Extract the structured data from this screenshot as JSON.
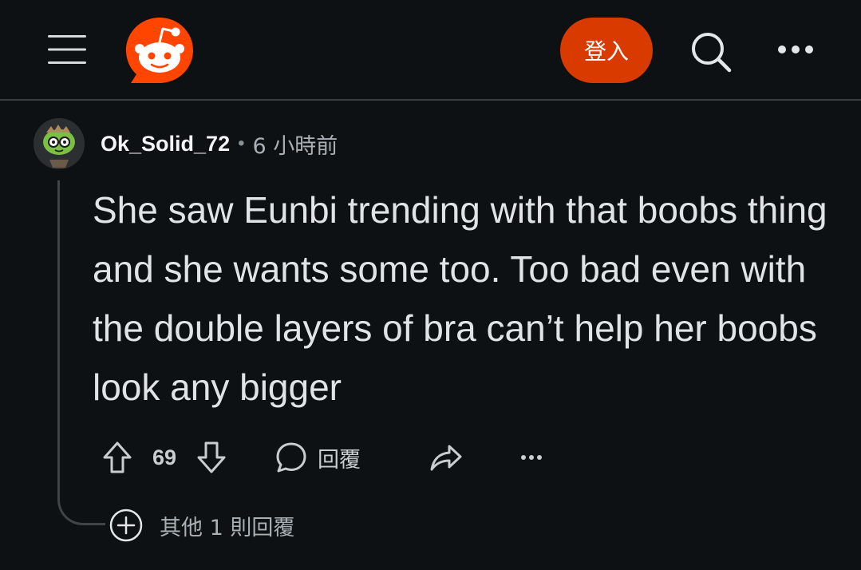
{
  "header": {
    "menu_icon": "hamburger-menu-icon",
    "logo_icon": "reddit-logo-icon",
    "login_label": "登入",
    "search_icon": "search-icon",
    "more_icon": "more-horizontal-icon"
  },
  "comment": {
    "avatar_icon": "user-avatar",
    "username": "Ok_Solid_72",
    "separator": "•",
    "time": "6 小時前",
    "body": "She saw Eunbi trending with that boobs thing and she wants some too. Too bad even with the double layers of bra can’t help her boobs look any bigger",
    "score": "69",
    "reply_label": "回覆",
    "more_replies_label": "其他 1 則回覆"
  },
  "colors": {
    "background": "#0e1113",
    "accent": "#d93a00",
    "logo": "#ff4500",
    "text": "#d7dadc"
  }
}
